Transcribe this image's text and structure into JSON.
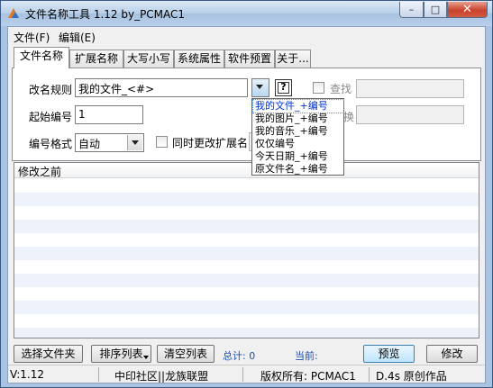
{
  "window": {
    "title": "文件名称工具 1.12  by_PCMAC1"
  },
  "menu": {
    "file": "文件(F)",
    "edit": "编辑(E)"
  },
  "tabs": [
    {
      "label": "文件名称"
    },
    {
      "label": "扩展名称"
    },
    {
      "label": "大写小写"
    },
    {
      "label": "系统属性"
    },
    {
      "label": "软件预置"
    },
    {
      "label": "关于..."
    }
  ],
  "form": {
    "rename_rule_label": "改名规则",
    "rename_rule_value": "我的文件_<#>",
    "help_label": "?",
    "find_label": "查找",
    "replace_label": "换",
    "start_number_label": "起始编号",
    "start_number_value": "1",
    "number_format_label": "编号格式",
    "number_format_value": "自动",
    "change_ext_label": "同时更改扩展名"
  },
  "dropdown": {
    "items": [
      "我的文件_+编号",
      "我的图片_+编号",
      "我的音乐_+编号",
      "仅仅编号",
      "今天日期_+编号",
      "原文件名_+编号"
    ]
  },
  "list": {
    "column_header": "修改之前"
  },
  "buttons": {
    "select_files": "选择文件夹",
    "sort_list": "排序列表",
    "clear_list": "清空列表",
    "total_label": "总计: 0",
    "current_label": "当前:",
    "preview": "预览",
    "modify": "修改"
  },
  "status": {
    "version": "V:1.12",
    "community": "中印社区||龙族联盟",
    "copyright": "版权所有: PCMAC1",
    "author": "D.4s 原创作品"
  }
}
